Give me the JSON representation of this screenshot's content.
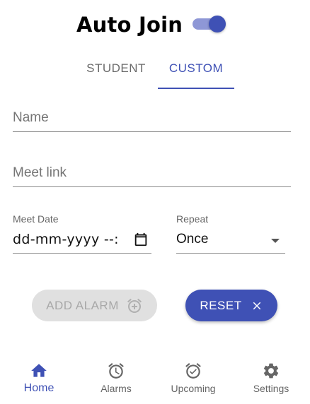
{
  "header": {
    "title": "Auto Join",
    "toggle_on": true
  },
  "tabs": [
    {
      "label": "STUDENT",
      "active": false
    },
    {
      "label": "CUSTOM",
      "active": true
    }
  ],
  "form": {
    "name_placeholder": "Name",
    "link_placeholder": "Meet link",
    "date_label": "Meet Date",
    "date_value": "dd-mm-yyyy --:",
    "repeat_label": "Repeat",
    "repeat_value": "Once"
  },
  "buttons": {
    "add_alarm": "ADD ALARM",
    "reset": "RESET"
  },
  "nav": [
    {
      "label": "Home",
      "icon": "home-icon",
      "active": true
    },
    {
      "label": "Alarms",
      "icon": "alarm-icon",
      "active": false
    },
    {
      "label": "Upcoming",
      "icon": "alarm-check-icon",
      "active": false
    },
    {
      "label": "Settings",
      "icon": "gear-icon",
      "active": false
    }
  ],
  "colors": {
    "primary": "#3f51b5",
    "toggle_track": "#8e97d6",
    "disabled_bg": "#e0e0e0",
    "disabled_text": "#a8a8a8"
  }
}
